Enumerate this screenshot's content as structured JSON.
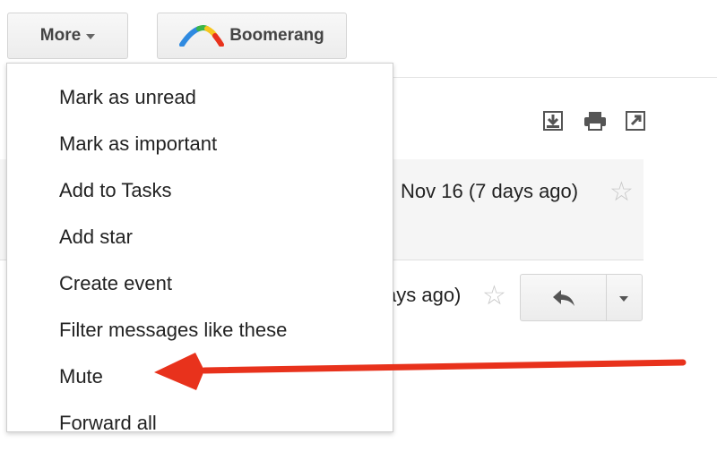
{
  "toolbar": {
    "more_label": "More",
    "boomerang_label": "Boomerang"
  },
  "thread": {
    "message1_date": "Nov 16 (7 days ago)",
    "message2_date_partial": "ays ago)"
  },
  "menu": {
    "items": [
      "Mark as unread",
      "Mark as important",
      "Add to Tasks",
      "Add star",
      "Create event",
      "Filter messages like these",
      "Mute",
      "Forward all"
    ]
  },
  "icons": {
    "top_right": [
      "download-icon",
      "print-icon",
      "new-window-icon"
    ],
    "star": "star-icon",
    "reply": "reply-icon"
  },
  "colors": {
    "annotation_arrow": "#e8321c",
    "boomerang_logo": [
      "#2f8ae0",
      "#3bb54a",
      "#f7c51e",
      "#e8321c"
    ]
  }
}
